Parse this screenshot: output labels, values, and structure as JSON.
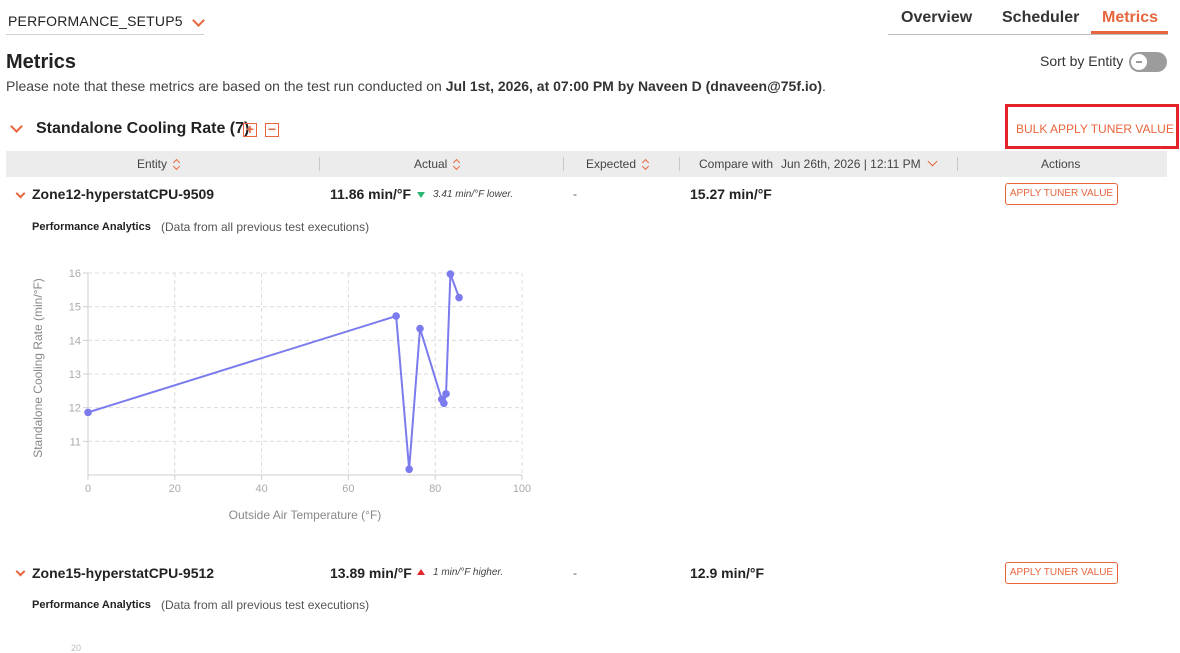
{
  "header": {
    "setup_name": "PERFORMANCE_SETUP5",
    "tabs": [
      {
        "label": "Overview",
        "active": false
      },
      {
        "label": "Scheduler",
        "active": false
      },
      {
        "label": "Metrics",
        "active": true
      }
    ],
    "accent_color": "#e8663d"
  },
  "page": {
    "title": "Metrics",
    "note_prefix": "Please note that these metrics are based on the test run conducted on ",
    "note_date": "Jul 1st, 2026, at 07:00 PM by Naveen D (dnaveen@75f.io)",
    "note_suffix": ".",
    "sort_label": "Sort by Entity",
    "sort_toggle_on": false
  },
  "section": {
    "title": "Standalone Cooling Rate (7)",
    "expand_icon": "+",
    "collapse_icon": "−",
    "bulk_action": "BULK APPLY TUNER VALUE",
    "highlight_color": "#e32329"
  },
  "table": {
    "headers": {
      "entity": "Entity",
      "actual": "Actual",
      "expected": "Expected",
      "compare_with": "Compare with",
      "compare_date": "Jun 26th, 2026 | 12:11 PM",
      "actions": "Actions"
    },
    "rows": [
      {
        "entity": "Zone12-hyperstatCPU-9509",
        "actual": "11.86 min/°F",
        "trend": "down",
        "delta": "3.41 min/°F lower.",
        "expected": "-",
        "compare": "15.27 min/°F",
        "action": "APPLY TUNER VALUE",
        "analytics_title": "Performance Analytics",
        "analytics_sub": "(Data from all previous test executions)"
      },
      {
        "entity": "Zone15-hyperstatCPU-9512",
        "actual": "13.89 min/°F",
        "trend": "up",
        "delta": "1 min/°F higher.",
        "expected": "-",
        "compare": "12.9 min/°F",
        "action": "APPLY TUNER VALUE",
        "analytics_title": "Performance Analytics",
        "analytics_sub": "(Data from all previous test executions)"
      }
    ]
  },
  "chart_data": {
    "type": "line",
    "title": "",
    "xlabel": "Outside Air Temperature (°F)",
    "ylabel": "Standalone Cooling Rate (min/°F)",
    "xlim": [
      0,
      100
    ],
    "ylim": [
      10,
      16
    ],
    "x_ticks": [
      0,
      20,
      40,
      60,
      80,
      100
    ],
    "y_ticks": [
      11,
      12,
      13,
      14,
      15,
      16
    ],
    "grid": true,
    "grid_style": "dashed",
    "line_color": "#7b7bee",
    "series": [
      {
        "x": [
          0,
          71,
          74,
          76.5,
          81.5,
          82,
          82.5,
          83.5,
          85.5
        ],
        "y": [
          11.86,
          14.72,
          10.17,
          14.35,
          12.25,
          12.13,
          12.41,
          15.97,
          15.27
        ]
      }
    ],
    "partial_next_chart_tick": "20"
  }
}
